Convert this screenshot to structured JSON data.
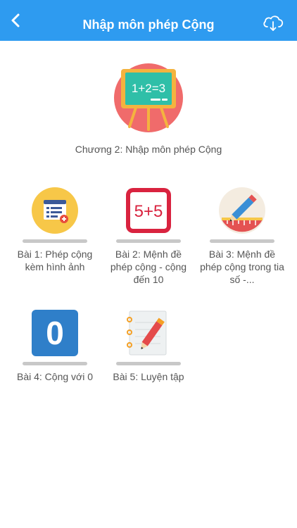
{
  "header": {
    "title": "Nhập môn phép Cộng",
    "back_icon": "chevron-left-icon",
    "action_icon": "cloud-download-icon",
    "bar_color": "#2e9bf0"
  },
  "chapter": {
    "icon": "chalkboard-icon",
    "board_text": "1+2=3",
    "title": "Chương 2: Nhập môn phép Cộng"
  },
  "lessons": [
    {
      "label": "Bài 1: Phép cộng kèm hình ảnh",
      "icon": "image-list-icon",
      "progress": 0
    },
    {
      "label": "Bài 2: Mệnh đề phép cộng - cộng đến 10",
      "icon": "five-plus-five-icon",
      "icon_text": "5+5",
      "progress": 0
    },
    {
      "label": "Bài 3: Mệnh đề phép cộng trong tia số -...",
      "icon": "pencil-ruler-icon",
      "progress": 0
    },
    {
      "label": "Bài 4: Cộng với 0",
      "icon": "zero-icon",
      "icon_text": "0",
      "progress": 0
    },
    {
      "label": "Bài 5: Luyện tập",
      "icon": "notebook-pencil-icon",
      "progress": 0
    }
  ]
}
